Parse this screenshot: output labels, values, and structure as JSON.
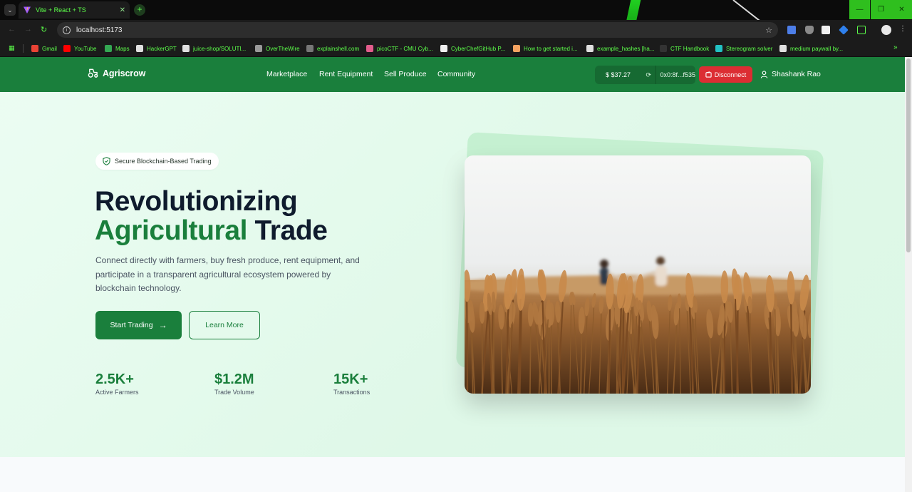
{
  "browser": {
    "tab_title": "Vite + React + TS",
    "url": "localhost:5173",
    "bookmarks": [
      {
        "label": "Gmail",
        "color": "#ea4335"
      },
      {
        "label": "YouTube",
        "color": "#ff0000"
      },
      {
        "label": "Maps",
        "color": "#34a853"
      },
      {
        "label": "HackerGPT",
        "color": "#e0e0e0"
      },
      {
        "label": "juice-shop/SOLUTI...",
        "color": "#e0e0e0"
      },
      {
        "label": "OverTheWire",
        "color": "#9a9a9a"
      },
      {
        "label": "explainshell.com",
        "color": "#777777"
      },
      {
        "label": "picoCTF - CMU Cyb...",
        "color": "#e25c8c"
      },
      {
        "label": "CyberChefGitHub P...",
        "color": "#f0f0f0"
      },
      {
        "label": "How to get started i...",
        "color": "#f4a261"
      },
      {
        "label": "example_hashes [ha...",
        "color": "#e0e0e0"
      },
      {
        "label": "CTF Handbook",
        "color": "#333333"
      },
      {
        "label": "Stereogram solver",
        "color": "#22c1c3"
      },
      {
        "label": "medium paywall by...",
        "color": "#e0e0e0"
      }
    ]
  },
  "app": {
    "brand": "Agriscrow",
    "nav": [
      "Marketplace",
      "Rent Equipment",
      "Sell Produce",
      "Community"
    ],
    "wallet": {
      "balance": "$ $37.27",
      "address": "0x0:8f...f535"
    },
    "disconnect_label": "Disconnect",
    "user_name": "Shashank Rao",
    "badge": "Secure Blockchain-Based Trading",
    "headline": {
      "line1": "Revolutionizing",
      "line2_green": "Agricultural",
      "line2_dark": "Trade"
    },
    "description": "Connect directly with farmers, buy fresh produce, rent equipment, and participate in a transparent agricultural ecosystem powered by blockchain technology.",
    "cta_primary": "Start Trading",
    "cta_secondary": "Learn More",
    "stats": [
      {
        "value": "2.5K+",
        "label": "Active Farmers"
      },
      {
        "value": "$1.2M",
        "label": "Trade Volume"
      },
      {
        "value": "15K+",
        "label": "Transactions"
      }
    ]
  },
  "colors": {
    "primary": "#1a7f3c",
    "danger": "#dc2d33",
    "heading": "#0f1b2d",
    "browser_accent": "#5cff4a"
  }
}
